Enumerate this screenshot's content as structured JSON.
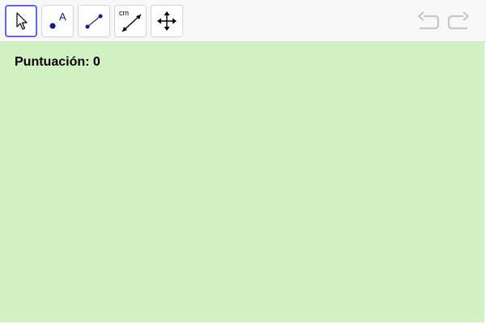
{
  "toolbar": {
    "tools": [
      {
        "id": "move",
        "icon": "pointer-arrow-icon",
        "active": true
      },
      {
        "id": "point",
        "icon": "point-icon",
        "label": "A"
      },
      {
        "id": "segment",
        "icon": "segment-icon"
      },
      {
        "id": "segment-length",
        "icon": "segment-length-icon",
        "label": "cm"
      },
      {
        "id": "move-graphics",
        "icon": "move-cross-icon"
      }
    ],
    "undo_icon": "undo-icon",
    "redo_icon": "redo-icon"
  },
  "graphics": {
    "background_color": "#d2f1c2",
    "score_label": "Puntuación:",
    "score_value": "0"
  },
  "colors": {
    "active_border": "#6666dd",
    "point_blue": "#1a1a8c",
    "history_disabled": "#c8c8c8"
  }
}
